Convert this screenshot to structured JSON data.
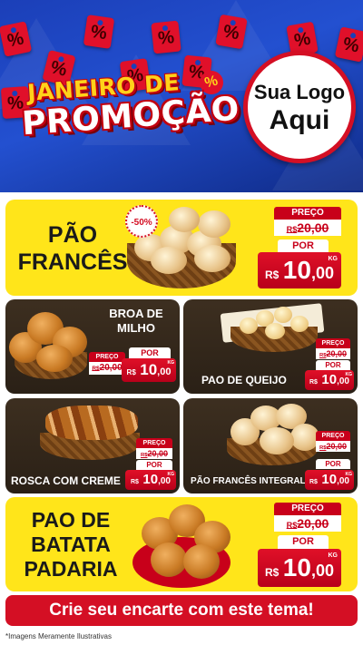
{
  "header": {
    "title_line1": "JANEIRO DE",
    "title_line2": "PROMOÇÃO",
    "percent_symbol": "%",
    "logo_line1": "Sua Logo",
    "logo_line2": "Aqui",
    "accent_color": "#d40f24",
    "background_color": "#1b3fb8"
  },
  "products": {
    "pao_frances": {
      "name_line1": "PÃO",
      "name_line2": "FRANCÊS",
      "discount": "-50%",
      "preco_label": "PREÇO",
      "old_currency": "R$",
      "old_value": "20,00",
      "por_label": "POR",
      "currency": "R$",
      "price_int": "10",
      "price_dec": ",00",
      "unit": "KG"
    },
    "broa_milho": {
      "name_line1": "BROA DE",
      "name_line2": "MILHO",
      "preco_label": "PREÇO",
      "old_currency": "R$",
      "old_value": "20,00",
      "por_label": "POR",
      "currency": "R$",
      "price_int": "10",
      "price_dec": ",00",
      "unit": "KG"
    },
    "pao_queijo": {
      "name": "PAO DE QUEIJO",
      "preco_label": "PREÇO",
      "old_currency": "R$",
      "old_value": "20,00",
      "por_label": "POR",
      "currency": "R$",
      "price_int": "10",
      "price_dec": ",00",
      "unit": "KG"
    },
    "rosca_creme": {
      "name": "ROSCA COM CREME",
      "preco_label": "PREÇO",
      "old_currency": "R$",
      "old_value": "20,00",
      "por_label": "POR",
      "currency": "R$",
      "price_int": "10",
      "price_dec": ",00",
      "unit": "KG"
    },
    "pao_integral": {
      "name": "PÃO FRANCÊS INTEGRAL",
      "preco_label": "PREÇO",
      "old_currency": "R$",
      "old_value": "20,00",
      "por_label": "POR",
      "currency": "R$",
      "price_int": "10",
      "price_dec": ",00",
      "unit": "KG"
    },
    "pao_batata": {
      "name_line1": "PAO DE",
      "name_line2": "BATATA",
      "name_line3": "PADARIA",
      "preco_label": "PREÇO",
      "old_currency": "R$",
      "old_value": "20,00",
      "por_label": "POR",
      "currency": "R$",
      "price_int": "10",
      "price_dec": ",00",
      "unit": "KG"
    }
  },
  "cta": {
    "label": "Crie seu encarte com este tema!"
  },
  "footer": {
    "disclaimer": "*Imagens Meramente Ilustrativas"
  }
}
